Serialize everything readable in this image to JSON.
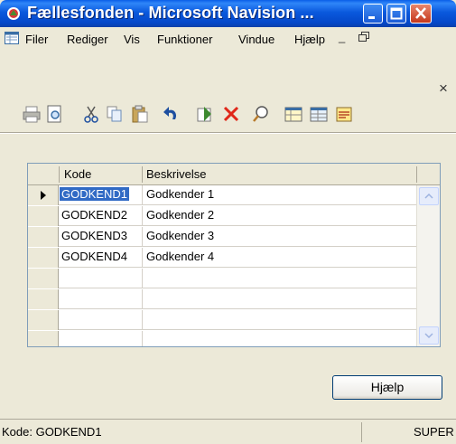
{
  "window": {
    "title": "Fællesfonden - Microsoft Navision ...",
    "accent": "#0A59DD"
  },
  "menu": {
    "items": [
      "Filer",
      "Rediger",
      "Vis",
      "Funktioner",
      "Vindue",
      "Hjælp"
    ],
    "mdi_min": "_",
    "mdi_restore": "🗗",
    "mdi_close": "×"
  },
  "toolbar": {
    "icons": [
      "print-icon",
      "print-preview-icon",
      "cut-icon",
      "copy-icon",
      "paste-icon",
      "undo-icon",
      "refresh-icon",
      "delete-icon",
      "find-icon",
      "table-icon",
      "list-icon",
      "report-icon"
    ]
  },
  "grid": {
    "columns": [
      "Kode",
      "Beskrivelse"
    ],
    "rows": [
      {
        "kode": "GODKEND1",
        "beskrivelse": "Godkender 1"
      },
      {
        "kode": "GODKEND2",
        "beskrivelse": "Godkender 2"
      },
      {
        "kode": "GODKEND3",
        "beskrivelse": "Godkender 3"
      },
      {
        "kode": "GODKEND4",
        "beskrivelse": "Godkender 4"
      }
    ]
  },
  "help_button": "Hjælp",
  "statusbar": {
    "left": "Kode: GODKEND1",
    "right": "SUPER"
  }
}
